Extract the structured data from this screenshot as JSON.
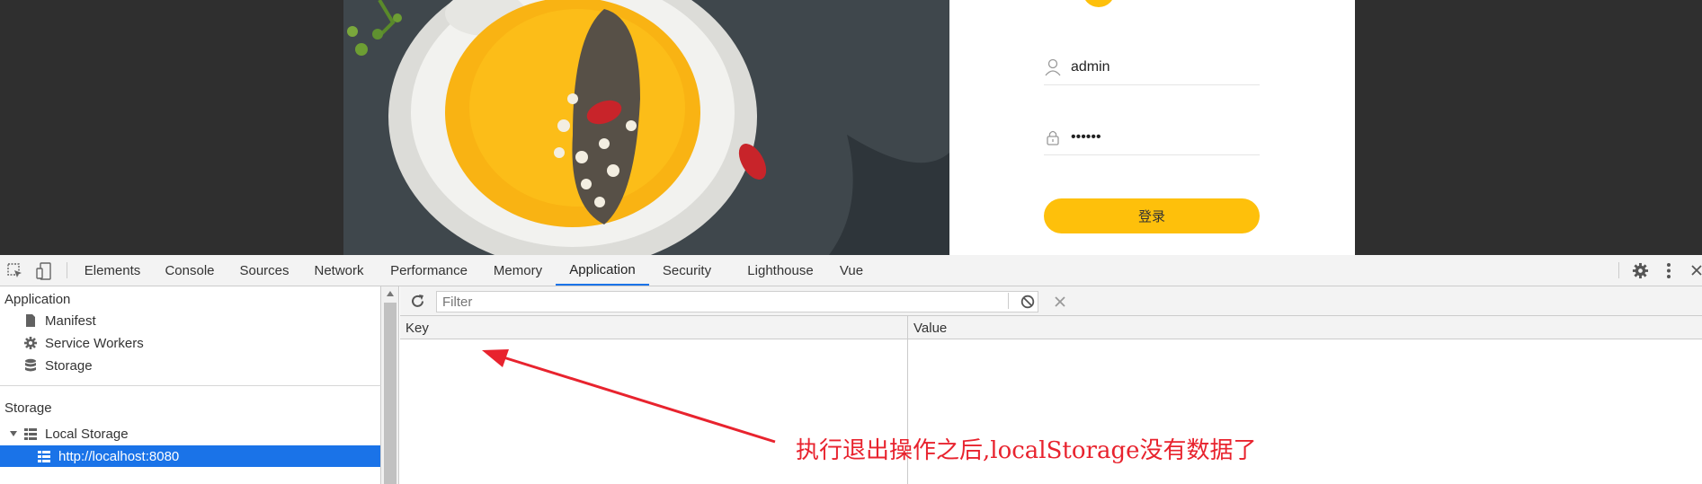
{
  "login": {
    "username": "admin",
    "password": "••••••",
    "button_label": "登录"
  },
  "devtools": {
    "tabs": [
      "Elements",
      "Console",
      "Sources",
      "Network",
      "Performance",
      "Memory",
      "Application",
      "Security",
      "Lighthouse",
      "Vue"
    ],
    "active_tab": "Application",
    "sidebar": {
      "application_heading": "Application",
      "application_items": [
        "Manifest",
        "Service Workers",
        "Storage"
      ],
      "storage_heading": "Storage",
      "local_storage_label": "Local Storage",
      "local_storage_origin": "http://localhost:8080"
    },
    "filter_placeholder": "Filter",
    "table_headers": {
      "key": "Key",
      "value": "Value"
    }
  },
  "annotation": {
    "text": "执行退出操作之后,localStorage没有数据了",
    "color": "#e8232e"
  },
  "colors": {
    "accent": "#1a73e8",
    "login_button": "#fec00b"
  },
  "icons": [
    "inspect-icon",
    "device-toggle-icon",
    "gear-icon",
    "more-icon",
    "close-icon",
    "refresh-icon",
    "clear-icon",
    "delete-icon",
    "file-icon",
    "database-icon",
    "grid-icon",
    "user-icon",
    "lock-icon"
  ]
}
